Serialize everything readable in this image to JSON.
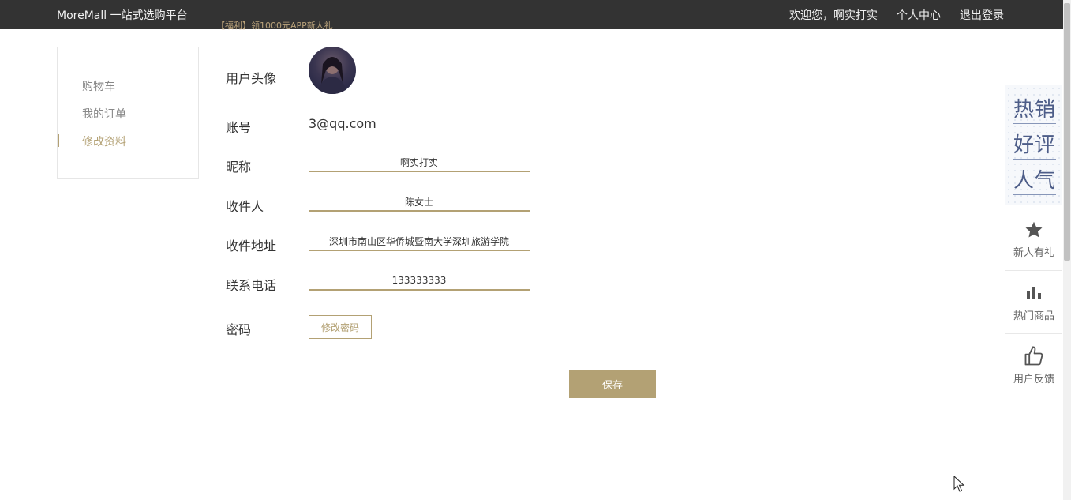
{
  "topbar": {
    "brand": "MoreMall 一站式选购平台",
    "promo": "【福利】领1000元APP新人礼",
    "welcome": "欢迎您，啊实打实",
    "user_center": "个人中心",
    "logout": "退出登录"
  },
  "sidebar": {
    "items": [
      {
        "label": "购物车"
      },
      {
        "label": "我的订单"
      },
      {
        "label": "修改资料"
      }
    ],
    "active": "修改资料"
  },
  "form": {
    "avatar_label": "用户头像",
    "account_label": "账号",
    "account_value": "3@qq.com",
    "nickname_label": "昵称",
    "nickname_value": "啊实打实",
    "recipient_label": "收件人",
    "recipient_value": "陈女士",
    "address_label": "收件地址",
    "address_value": "深圳市南山区华侨城暨南大学深圳旅游学院",
    "phone_label": "联系电话",
    "phone_value": "133333333",
    "password_label": "密码",
    "change_password": "修改密码",
    "save": "保存"
  },
  "right_panel": {
    "hot_lines": [
      "热销",
      "好评",
      "人气"
    ],
    "items": [
      {
        "label": "新人有礼",
        "icon": "star-icon"
      },
      {
        "label": "热门商品",
        "icon": "bar-chart-icon"
      },
      {
        "label": "用户反馈",
        "icon": "thumbs-up-icon"
      }
    ]
  },
  "colors": {
    "accent": "#b3a174",
    "topbar_bg": "#333333",
    "hot_text": "#4d5d88"
  }
}
